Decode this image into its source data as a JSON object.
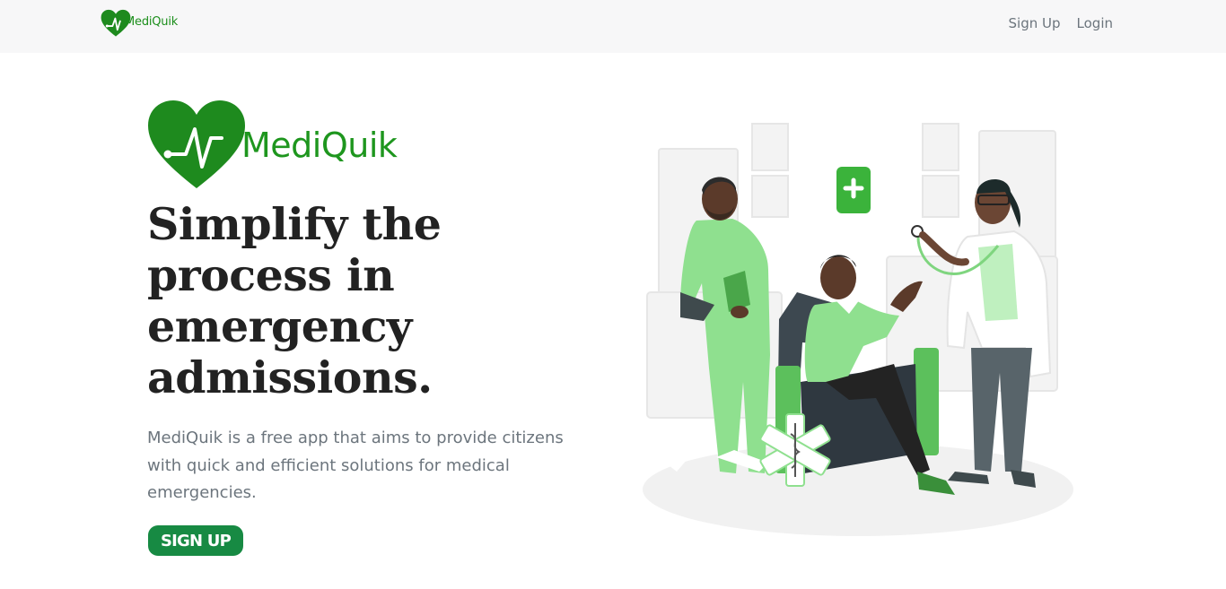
{
  "navbar": {
    "brand": "MediQuik",
    "links": [
      "Sign Up",
      "Login"
    ]
  },
  "hero": {
    "logo_text": "MediQuik",
    "headline": "Simplify the process in emergency admissions.",
    "description": "MediQuik is a free app that aims to provide citizens with quick and efficient solutions for medical emergencies.",
    "cta_label": "SIGN UP"
  },
  "colors": {
    "brand_green": "#1e961e",
    "button_green": "#178a43",
    "navbar_bg": "#f7f7f8",
    "text_dark": "#222222",
    "text_muted": "#6c757d"
  },
  "icons": [
    "heart-ecg-logo-icon",
    "medical-cross-icon",
    "star-of-life-icon",
    "stethoscope-icon"
  ]
}
